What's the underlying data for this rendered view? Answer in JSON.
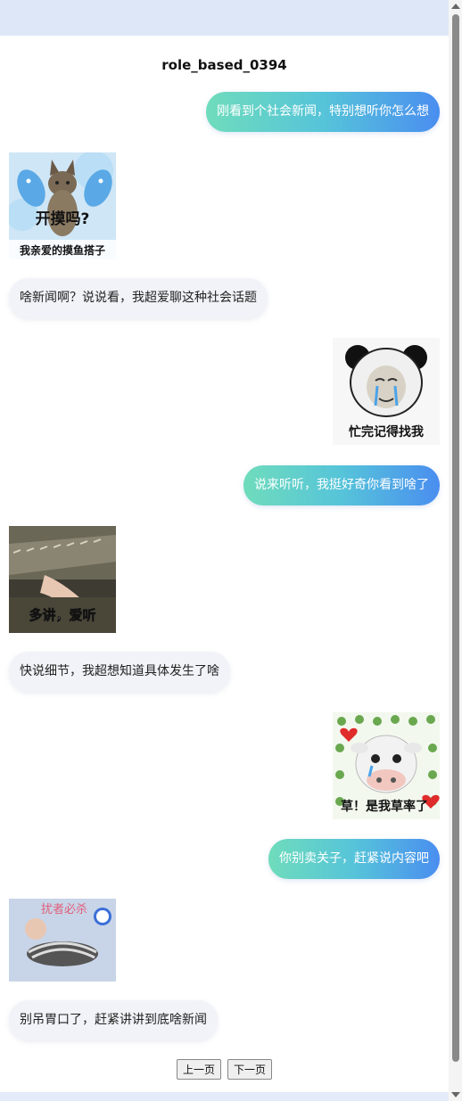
{
  "title": "role_based_0394",
  "messages": [
    {
      "side": "right",
      "type": "text",
      "text": "刚看到个社会新闻，特别想听你怎么想"
    },
    {
      "side": "left",
      "type": "sticker",
      "caption_top": "开摸吗?",
      "caption": "我亲爱的摸鱼搭子"
    },
    {
      "side": "left",
      "type": "text",
      "text": "啥新闻啊？说说看，我超爱聊这种社会话题"
    },
    {
      "side": "right",
      "type": "sticker",
      "caption": "忙完记得找我"
    },
    {
      "side": "right",
      "type": "text",
      "text": "说来听听，我挺好奇你看到啥了"
    },
    {
      "side": "left",
      "type": "sticker",
      "caption": "多讲，爱听"
    },
    {
      "side": "left",
      "type": "text",
      "text": "快说细节，我超想知道具体发生了啥"
    },
    {
      "side": "right",
      "type": "sticker",
      "caption": "草！是我草率了"
    },
    {
      "side": "right",
      "type": "text",
      "text": "你别卖关子，赶紧说内容吧"
    },
    {
      "side": "left",
      "type": "sticker",
      "caption": "扰者必杀"
    },
    {
      "side": "left",
      "type": "text",
      "text": "别吊胃口了，赶紧讲讲到底啥新闻"
    }
  ],
  "pager": {
    "prev": "上一页",
    "next": "下一页"
  },
  "colors": {
    "bubble_right_start": "#6fdcbc",
    "bubble_right_end": "#4a8ef0",
    "bubble_left": "#f1f3f8"
  }
}
